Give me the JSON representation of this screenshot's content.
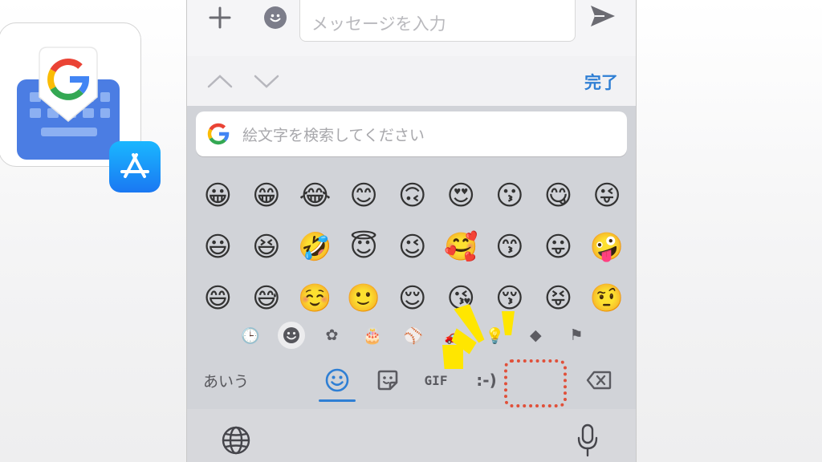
{
  "app": {
    "logo_icon": "gboard-logo",
    "store_badge_icon": "app-store-icon",
    "colors": {
      "badge": "#1a78f2",
      "keyboard_blue": "#4b7de3"
    }
  },
  "compose": {
    "placeholder": "メッセージを入力",
    "plus_icon": "plus-icon",
    "emoji_icon": "smiley-icon",
    "send_icon": "send-icon"
  },
  "toolbar": {
    "done_label": "完了",
    "accent": "#2f7fd4"
  },
  "keyboard": {
    "search_placeholder": "絵文字を検索してください",
    "emojis": [
      "😀",
      "😁",
      "😂",
      "😊",
      "🙃",
      "😍",
      "😗",
      "😋",
      "😜",
      "😃",
      "😆",
      "🤣",
      "😇",
      "😉",
      "🥰",
      "😙",
      "😛",
      "🤪",
      "😄",
      "😅",
      "☺️",
      "🙂",
      "😌",
      "😘",
      "😚",
      "😝",
      "🤨"
    ],
    "categories": [
      {
        "name": "recent",
        "glyph": "🕒"
      },
      {
        "name": "smileys",
        "glyph": ""
      },
      {
        "name": "animals",
        "glyph": "✿"
      },
      {
        "name": "food",
        "glyph": "🎂"
      },
      {
        "name": "activities",
        "glyph": "⚾"
      },
      {
        "name": "travel",
        "glyph": "🚗"
      },
      {
        "name": "objects",
        "glyph": "💡"
      },
      {
        "name": "symbols",
        "glyph": "◆"
      },
      {
        "name": "flags",
        "glyph": "⚑"
      }
    ],
    "mode_kana": "あいう",
    "mode_gif": "GIF",
    "mode_emoticon": ":-)"
  }
}
